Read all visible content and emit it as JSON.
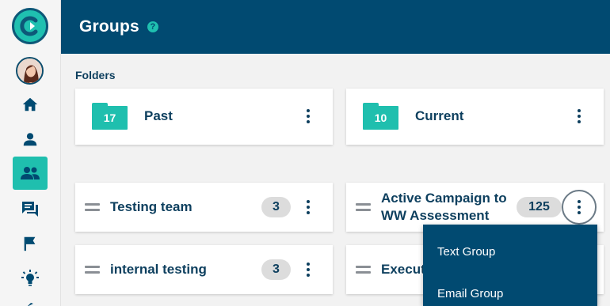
{
  "header": {
    "title": "Groups",
    "help_glyph": "?"
  },
  "sidebar": {
    "items": [
      {
        "name": "home",
        "icon": "home-icon"
      },
      {
        "name": "contacts",
        "icon": "person-icon"
      },
      {
        "name": "groups",
        "icon": "people-icon",
        "active": true
      },
      {
        "name": "messages",
        "icon": "chat-icon"
      },
      {
        "name": "campaigns",
        "icon": "flag-icon"
      },
      {
        "name": "ideas",
        "icon": "lightbulb-icon"
      }
    ]
  },
  "folders_section": {
    "label": "Folders"
  },
  "folders": [
    {
      "name": "Past",
      "count": "17"
    },
    {
      "name": "Current",
      "count": "10"
    }
  ],
  "groups": [
    {
      "name": "Testing team",
      "count": "3"
    },
    {
      "name": "Active Campaign to WW Assessment",
      "name_line1": "Active Campaign to",
      "name_line2": "WW Assessment",
      "count": "125"
    },
    {
      "name": "internal testing",
      "count": "3"
    },
    {
      "name": "Execut"
    }
  ],
  "dropdown": {
    "items": [
      {
        "label": "Text Group"
      },
      {
        "label": "Email Group"
      }
    ]
  },
  "colors": {
    "header_bg": "#014a71",
    "accent": "#1fbfae",
    "text_dark": "#0d3f5e"
  }
}
